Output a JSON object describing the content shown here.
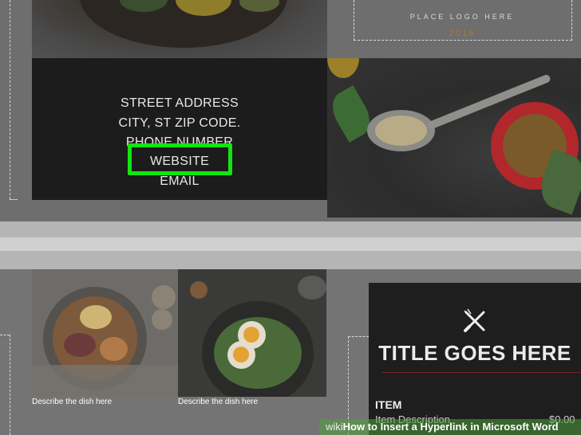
{
  "top_section": {
    "logo_placeholder": "PLACE LOGO HERE",
    "logo_year": "2019"
  },
  "contact_panel": {
    "street": "STREET ADDRESS",
    "city": "CITY, ST ZIP CODE.",
    "phone": "PHONE NUMBER",
    "website": "WEBSITE",
    "email": "EMAIL"
  },
  "dishes": [
    {
      "description": "Describe the dish here"
    },
    {
      "description": "Describe the dish here"
    }
  ],
  "menu_card": {
    "icon": "fork-knife-icon",
    "title": "TITLE GOES HERE",
    "item_label": "ITEM",
    "item_description": "Item Description",
    "item_price": "$0.00"
  },
  "watermark": {
    "prefix": "wiki",
    "text": "How to Insert a Hyperlink in Microsoft Word"
  },
  "colors": {
    "highlight": "#12e412",
    "panel": "#1c1c1c",
    "accent_rule": "#7a2020"
  }
}
